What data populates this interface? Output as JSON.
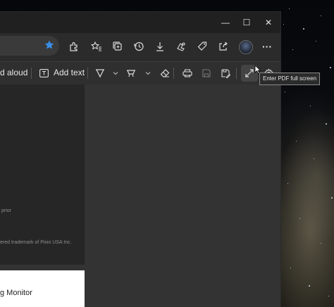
{
  "window": {
    "controls": {
      "minimize": "—",
      "maximize": "☐",
      "close": "✕"
    }
  },
  "address_bar": {
    "favorite_color": "#3a8ee6",
    "icons": [
      "extensions-icon",
      "favorites-icon",
      "collections-icon",
      "history-icon",
      "downloads-icon",
      "games-icon",
      "shopping-icon",
      "share-icon",
      "profile-avatar",
      "more-icon"
    ],
    "more_label": "···"
  },
  "pdf_toolbar": {
    "read_aloud_label": "d aloud",
    "add_text_label": "Add text",
    "icons": [
      "draw-icon",
      "chevron-down-icon",
      "highlight-icon",
      "chevron-down-icon",
      "erase-icon",
      "print-icon",
      "save-icon",
      "save-as-icon",
      "fullscreen-icon",
      "settings-icon"
    ]
  },
  "tooltip": {
    "text": "Enter PDF full screen"
  },
  "document": {
    "page1_line1": "prior",
    "page1_line2": "ered trademark of Pixio USA Inc.",
    "page2_heading": "g Monitor"
  }
}
